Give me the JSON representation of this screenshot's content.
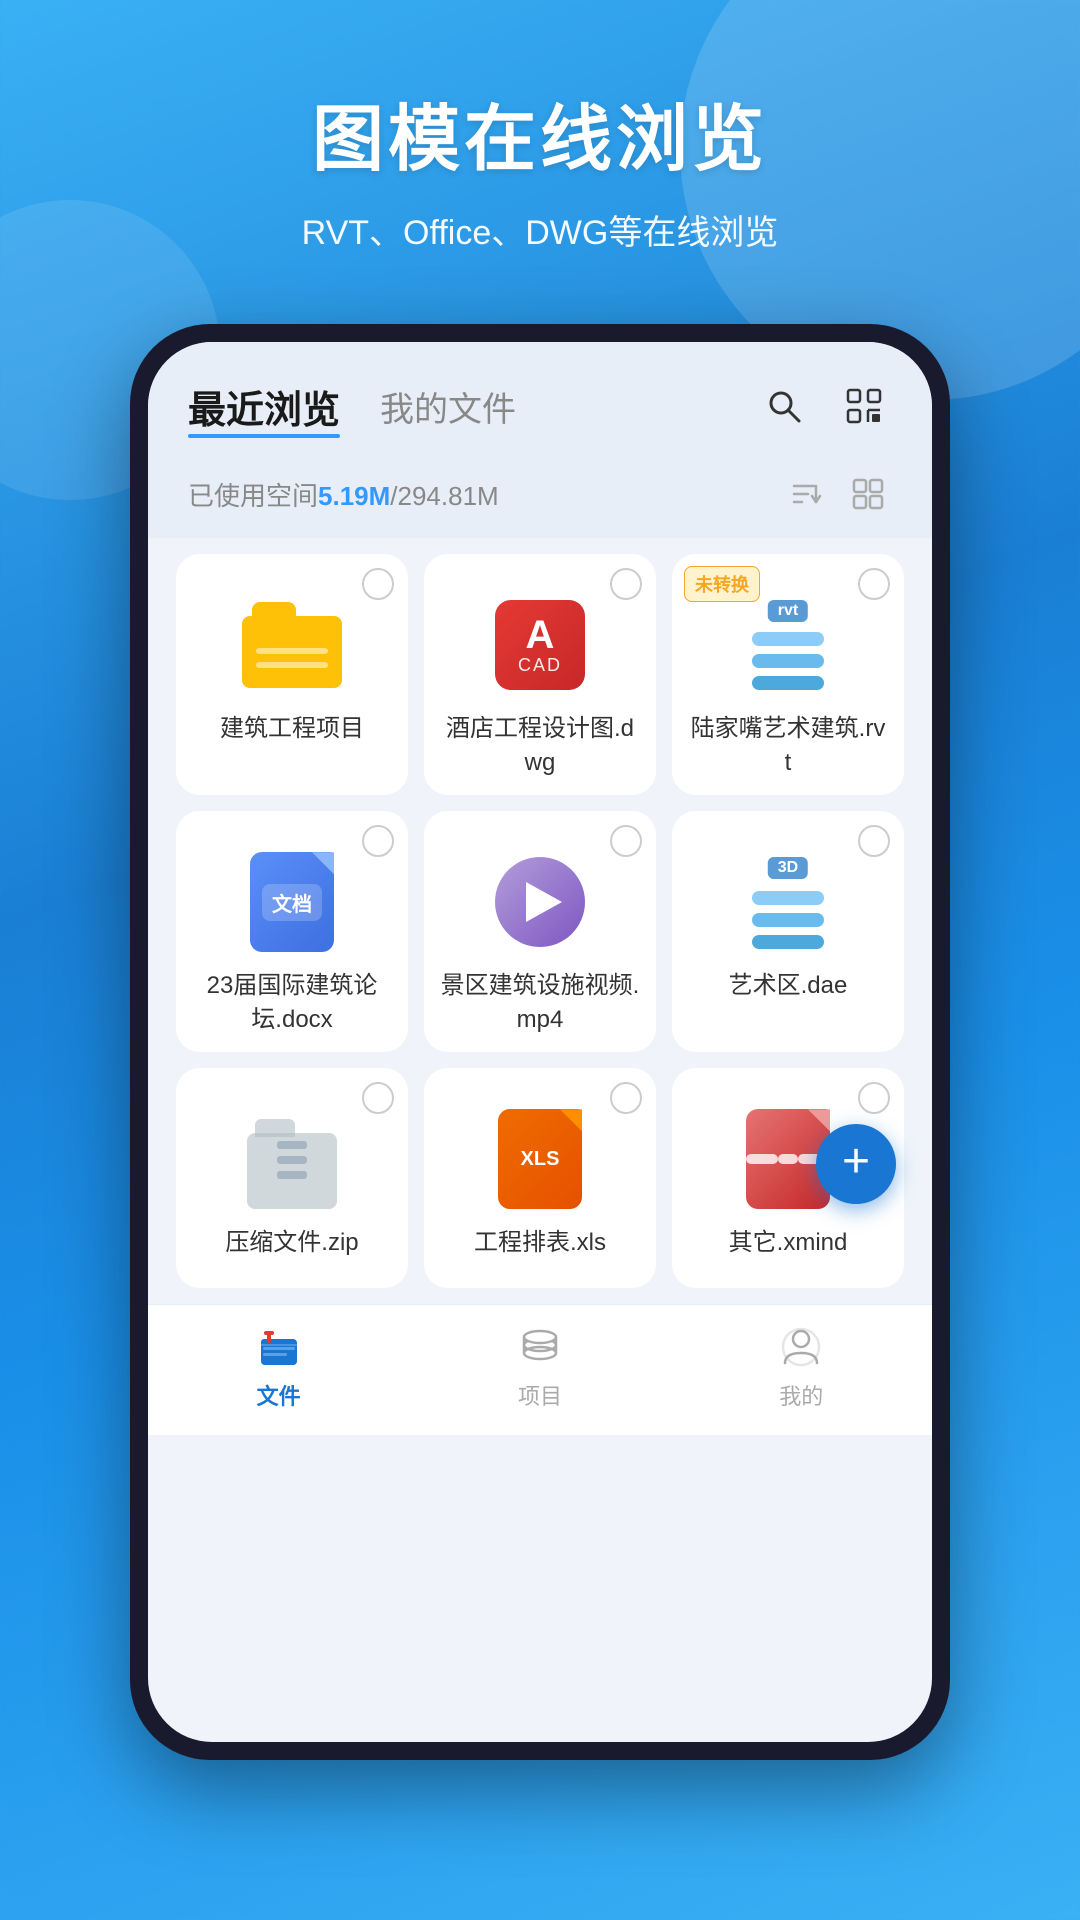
{
  "header": {
    "title": "图模在线浏览",
    "subtitle": "RVT、Office、DWG等在线浏览"
  },
  "nav": {
    "tab_recent": "最近浏览",
    "tab_myfiles": "我的文件",
    "search_icon": "search-icon",
    "scan_icon": "scan-icon"
  },
  "storage": {
    "label_prefix": "已使用空间",
    "used": "5.19M",
    "separator": "/",
    "total": "294.81M"
  },
  "files": [
    {
      "id": "file1",
      "name": "建筑工程项目",
      "type": "folder",
      "badge": null
    },
    {
      "id": "file2",
      "name": "酒店工程设计图.dwg",
      "type": "cad",
      "badge": null
    },
    {
      "id": "file3",
      "name": "陆家嘴艺术建筑.rvt",
      "type": "rvt",
      "badge": "未转换"
    },
    {
      "id": "file4",
      "name": "23届国际建筑论坛.docx",
      "type": "doc",
      "badge": null
    },
    {
      "id": "file5",
      "name": "景区建筑设施视频.mp4",
      "type": "video",
      "badge": null
    },
    {
      "id": "file6",
      "name": "艺术区.dae",
      "type": "dae",
      "badge": null
    },
    {
      "id": "file7",
      "name": "压缩文件.zip",
      "type": "zip",
      "badge": null
    },
    {
      "id": "file8",
      "name": "工程排表.xls",
      "type": "xls",
      "badge": null
    },
    {
      "id": "file9",
      "name": "其它.xmind",
      "type": "xmind",
      "badge": null
    }
  ],
  "fab": {
    "label": "+"
  },
  "bottom_tabs": [
    {
      "id": "tab-files",
      "label": "文件",
      "active": true
    },
    {
      "id": "tab-projects",
      "label": "项目",
      "active": false
    },
    {
      "id": "tab-mine",
      "label": "我的",
      "active": false
    }
  ],
  "colors": {
    "accent": "#3399ff",
    "bg_gradient_start": "#3ab0f5",
    "bg_gradient_end": "#1a7fd4",
    "card_bg": "#ffffff"
  }
}
